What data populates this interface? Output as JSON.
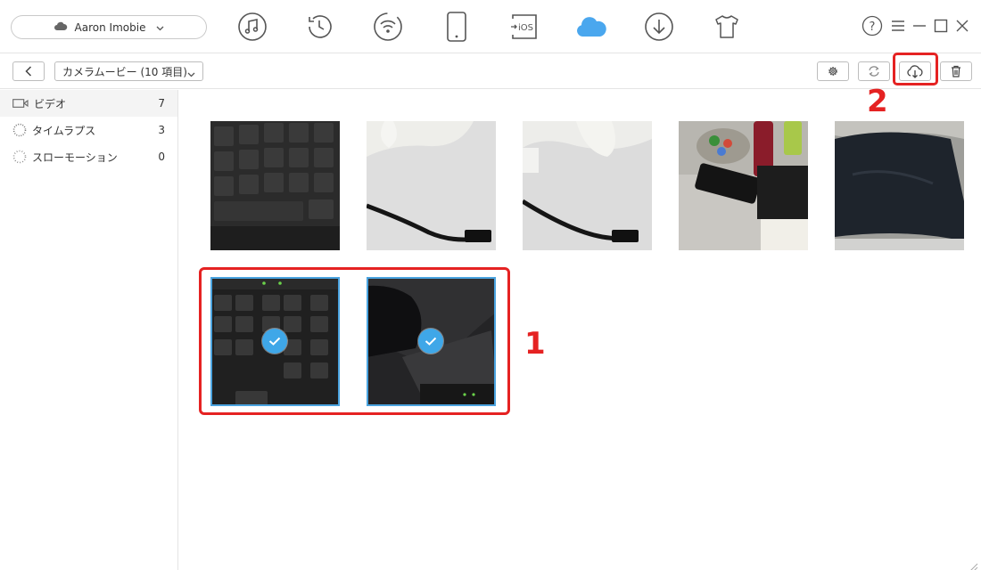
{
  "account": {
    "name": "Aaron  Imobie"
  },
  "nav": {
    "items": [
      {
        "icon": "music-icon"
      },
      {
        "icon": "history-icon"
      },
      {
        "icon": "wifi-icon"
      },
      {
        "icon": "device-icon"
      },
      {
        "icon": "ios-icon",
        "label": "iOS"
      },
      {
        "icon": "icloud-icon"
      },
      {
        "icon": "download-icon"
      },
      {
        "icon": "tshirt-icon"
      }
    ],
    "active": "icloud-icon"
  },
  "window_controls": {
    "help": "?"
  },
  "toolbar": {
    "album": "カメラムービー (10 項目)"
  },
  "sidebar": {
    "items": [
      {
        "label": "ビデオ",
        "count": "7"
      },
      {
        "label": "タイムラプス",
        "count": "3"
      },
      {
        "label": "スローモーション",
        "count": "0"
      }
    ]
  },
  "annotations": {
    "num1": "1",
    "num2": "2"
  },
  "colors": {
    "accent": "#3fa7e8",
    "annotation": "#e52222",
    "icloud": "#4aa7ee"
  }
}
